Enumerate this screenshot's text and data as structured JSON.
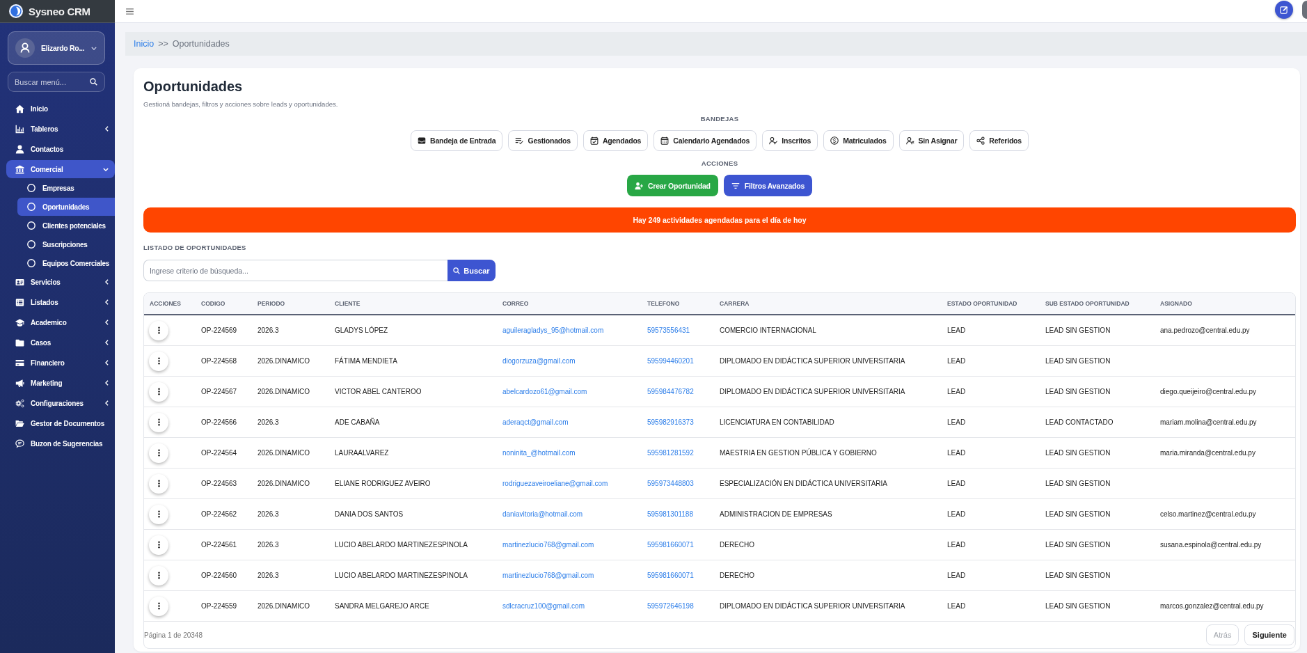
{
  "app": {
    "name": "Sysneo CRM"
  },
  "user": {
    "name": "Elizardo Ro..."
  },
  "menu_search": {
    "placeholder": "Buscar menú..."
  },
  "sidebar": {
    "items": [
      {
        "label": "Inicio",
        "kind": "link",
        "selected": false
      },
      {
        "label": "Tableros",
        "kind": "group",
        "selected": false,
        "expanded": false
      },
      {
        "label": "Contactos",
        "kind": "link",
        "selected": false
      },
      {
        "label": "Comercial",
        "kind": "group",
        "selected": true,
        "expanded": true,
        "children": [
          {
            "label": "Empresas",
            "selected": false
          },
          {
            "label": "Oportunidades",
            "selected": true
          },
          {
            "label": "Clientes potenciales",
            "selected": false
          },
          {
            "label": "Suscripciones",
            "selected": false
          },
          {
            "label": "Equipos Comerciales",
            "selected": false
          }
        ]
      },
      {
        "label": "Servicios",
        "kind": "group",
        "selected": false,
        "expanded": false
      },
      {
        "label": "Listados",
        "kind": "group",
        "selected": false,
        "expanded": false
      },
      {
        "label": "Academico",
        "kind": "group",
        "selected": false,
        "expanded": false
      },
      {
        "label": "Casos",
        "kind": "group",
        "selected": false,
        "expanded": false
      },
      {
        "label": "Financiero",
        "kind": "group",
        "selected": false,
        "expanded": false
      },
      {
        "label": "Marketing",
        "kind": "group",
        "selected": false,
        "expanded": false
      },
      {
        "label": "Configuraciones",
        "kind": "group",
        "selected": false,
        "expanded": false
      },
      {
        "label": "Gestor de Documentos",
        "kind": "link",
        "selected": false
      },
      {
        "label": "Buzon de Sugerencias",
        "kind": "link",
        "selected": false
      }
    ]
  },
  "breadcrumb": {
    "items": [
      "Inicio",
      "Oportunidades"
    ],
    "separator": ">>"
  },
  "page": {
    "title": "Oportunidades",
    "subtitle": "Gestioná bandejas, filtros y acciones sobre leads y oportunidades."
  },
  "bandejas": {
    "heading": "BANDEJAS",
    "buttons": [
      "Bandeja de Entrada",
      "Gestionados",
      "Agendados",
      "Calendario Agendados",
      "Inscritos",
      "Matriculados",
      "Sin Asignar",
      "Referidos"
    ]
  },
  "acciones": {
    "heading": "ACCIONES",
    "buttons": [
      {
        "label": "Crear Oportunidad",
        "color": "#28a745"
      },
      {
        "label": "Filtros Avanzados",
        "color": "#3d55d1"
      }
    ]
  },
  "alert": {
    "text": "Hay 249 actividades agendadas para el día de hoy"
  },
  "listado": {
    "heading": "LISTADO DE OPORTUNIDADES",
    "search": {
      "placeholder": "Ingrese criterio de búsqueda...",
      "button": "Buscar"
    }
  },
  "table": {
    "columns": [
      "ACCIONES",
      "CODIGO",
      "PERIODO",
      "CLIENTE",
      "CORREO",
      "TELEFONO",
      "CARRERA",
      "ESTADO OPORTUNIDAD",
      "SUB ESTADO OPORTUNIDAD",
      "ASIGNADO"
    ],
    "rows": [
      {
        "codigo": "OP-224569",
        "periodo": "2026.3",
        "cliente": "GLADYS LÓPEZ",
        "correo": "aguileragladys_95@hotmail.com",
        "telefono": "59573556431",
        "carrera": "COMERCIO INTERNACIONAL",
        "estado": "LEAD",
        "sub_estado": "LEAD SIN GESTION",
        "asignado": "ana.pedrozo@central.edu.py"
      },
      {
        "codigo": "OP-224568",
        "periodo": "2026.DINAMICO",
        "cliente": "FÁTIMA MENDIETA",
        "correo": "diogorzuza@gmail.com",
        "telefono": "595994460201",
        "carrera": "DIPLOMADO EN DIDÁCTICA SUPERIOR UNIVERSITARIA",
        "estado": "LEAD",
        "sub_estado": "LEAD SIN GESTION"
      },
      {
        "codigo": "OP-224567",
        "periodo": "2026.DINAMICO",
        "cliente": "VICTOR ABEL CANTEROO",
        "correo": "abelcardozo61@gmail.com",
        "telefono": "595984476782",
        "carrera": "DIPLOMADO EN DIDÁCTICA SUPERIOR UNIVERSITARIA",
        "estado": "LEAD",
        "sub_estado": "LEAD SIN GESTION",
        "asignado": "diego.queijeiro@central.edu.py"
      },
      {
        "codigo": "OP-224566",
        "periodo": "2026.3",
        "cliente": "ADE CABAÑA",
        "correo": "aderaqct@gmail.com",
        "telefono": "595982916373",
        "carrera": "LICENCIATURA EN CONTABILIDAD",
        "estado": "LEAD",
        "sub_estado": "LEAD CONTACTADO",
        "asignado": "mariam.molina@central.edu.py"
      },
      {
        "codigo": "OP-224564",
        "periodo": "2026.DINAMICO",
        "cliente": "LAURAALVAREZ",
        "correo": "noninita_@hotmail.com",
        "telefono": "595981281592",
        "carrera": "MAESTRIA EN GESTION PÚBLICA Y GOBIERNO",
        "estado": "LEAD",
        "sub_estado": "LEAD SIN GESTION",
        "asignado": "maria.miranda@central.edu.py"
      },
      {
        "codigo": "OP-224563",
        "periodo": "2026.DINAMICO",
        "cliente": "ELIANE RODRIGUEZ AVEIRO",
        "correo": "rodriguezaveiroeliane@gmail.com",
        "telefono": "595973448803",
        "carrera": "ESPECIALIZACIÓN EN DIDÁCTICA UNIVERSITARIA",
        "estado": "LEAD",
        "sub_estado": "LEAD SIN GESTION"
      },
      {
        "codigo": "OP-224562",
        "periodo": "2026.3",
        "cliente": "DANIA DOS SANTOS",
        "correo": "daniavitoria@hotmail.com",
        "telefono": "595981301188",
        "carrera": "ADMINISTRACION DE EMPRESAS",
        "estado": "LEAD",
        "sub_estado": "LEAD SIN GESTION",
        "asignado": "celso.martinez@central.edu.py"
      },
      {
        "codigo": "OP-224561",
        "periodo": "2026.3",
        "cliente": "LUCIO ABELARDO MARTINEZESPINOLA",
        "correo": "martinezlucio768@gmail.com",
        "telefono": "595981660071",
        "carrera": "DERECHO",
        "estado": "LEAD",
        "sub_estado": "LEAD SIN GESTION",
        "asignado": "susana.espinola@central.edu.py"
      },
      {
        "codigo": "OP-224560",
        "periodo": "2026.3",
        "cliente": "LUCIO ABELARDO MARTINEZESPINOLA",
        "correo": "martinezlucio768@gmail.com",
        "telefono": "595981660071",
        "carrera": "DERECHO",
        "estado": "LEAD",
        "sub_estado": "LEAD SIN GESTION"
      },
      {
        "codigo": "OP-224559",
        "periodo": "2026.DINAMICO",
        "cliente": "SANDRA MELGAREJO ARCE",
        "correo": "sdlcracruz100@gmail.com",
        "telefono": "595972646198",
        "carrera": "DIPLOMADO EN DIDÁCTICA SUPERIOR UNIVERSITARIA",
        "estado": "LEAD",
        "sub_estado": "LEAD SIN GESTION",
        "asignado": "marcos.gonzalez@central.edu.py"
      }
    ]
  },
  "pagination": {
    "info": "Página 1 de 20348",
    "previous": {
      "label": "Atrás",
      "disabled": true
    },
    "next": {
      "label": "Siguiente",
      "disabled": false
    }
  }
}
